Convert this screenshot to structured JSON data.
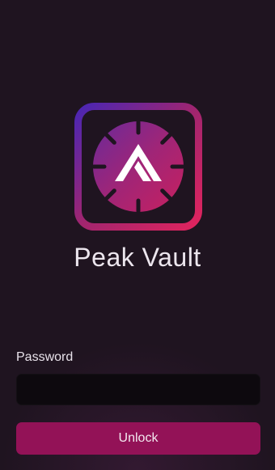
{
  "app": {
    "name": "Peak Vault",
    "logo_icon": "peak-vault-logo-icon"
  },
  "form": {
    "password_label": "Password",
    "password_value": "",
    "password_placeholder": "",
    "unlock_label": "Unlock"
  },
  "colors": {
    "background": "#1f1420",
    "accent": "#931257",
    "input_background": "#0d090e",
    "logo_gradient_start": "#4a26b3",
    "logo_gradient_end": "#e0245e"
  }
}
